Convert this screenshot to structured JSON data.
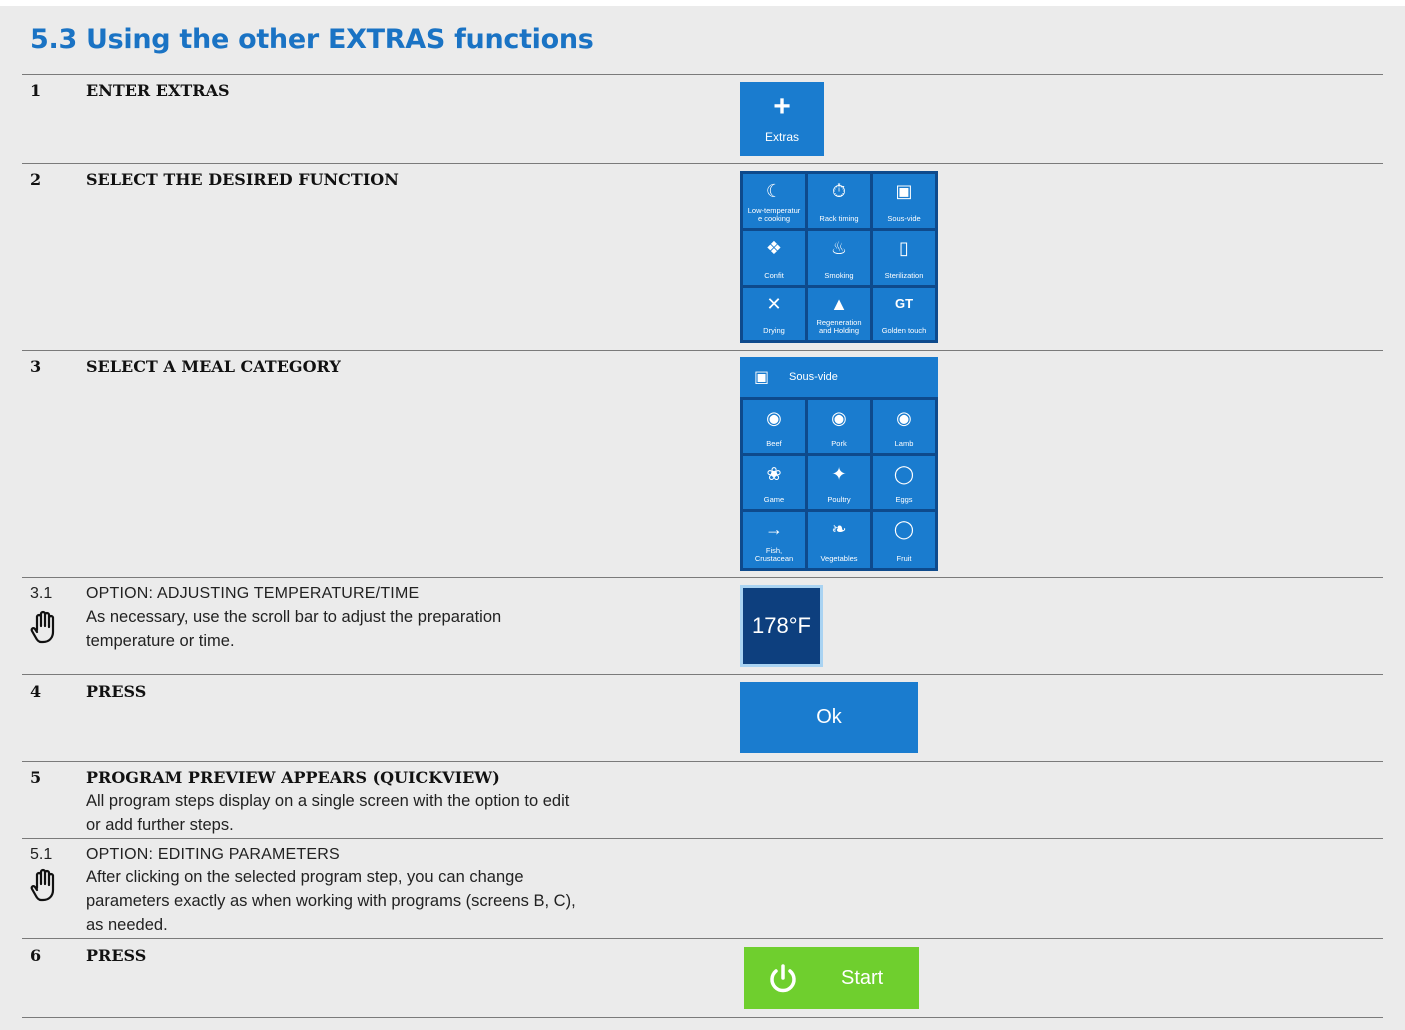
{
  "title": "5.3 Using the other EXTRAS functions",
  "steps": {
    "s1": {
      "num": "1",
      "head": "ENTER EXTRAS"
    },
    "s2": {
      "num": "2",
      "head": "SELECT THE DESIRED FUNCTION"
    },
    "s3": {
      "num": "3",
      "head": "SELECT A MEAL CATEGORY"
    },
    "s31": {
      "num": "3.1",
      "head": "OPTION: ADJUSTING TEMPERATURE/TIME",
      "line1": "As necessary, use the scroll bar to adjust the preparation",
      "line2": "temperature or time."
    },
    "s4": {
      "num": "4",
      "head": "PRESS"
    },
    "s5": {
      "num": "5",
      "head": "PROGRAM PREVIEW APPEARS (QUICKVIEW)",
      "line1": "All program steps display on a single screen with the option to edit",
      "line2": "or add further steps."
    },
    "s51": {
      "num": "5.1",
      "head": "OPTION: EDITING PARAMETERS",
      "line1": "After clicking on the selected program step, you can change",
      "line2": "parameters exactly as when working with programs (screens B, C),",
      "line3": "as needed."
    },
    "s6": {
      "num": "6",
      "head": "PRESS"
    }
  },
  "extras_button": {
    "label": "Extras",
    "icon": "plus-icon"
  },
  "functions": [
    {
      "label": "Low-temperatur e cooking",
      "l1": "Low-temperatur",
      "l2": "e cooking",
      "icon": "moon-chicken-icon"
    },
    {
      "label": "Rack timing",
      "icon": "stopwatch-icon"
    },
    {
      "label": "Sous-vide",
      "icon": "vacuum-bag-icon"
    },
    {
      "label": "Confit",
      "icon": "duck-icon"
    },
    {
      "label": "Smoking",
      "icon": "smoke-bowl-icon"
    },
    {
      "label": "Sterilization",
      "icon": "jar-icon"
    },
    {
      "label": "Drying",
      "icon": "dry-pear-icon"
    },
    {
      "label": "Regeneration and Holding",
      "l1": "Regeneration",
      "l2": "and Holding",
      "icon": "cloche-icon"
    },
    {
      "label": "Golden touch",
      "icon": "gt-icon"
    }
  ],
  "category_panel": {
    "header": "Sous-vide",
    "header_icon": "vacuum-bag-icon"
  },
  "categories": [
    {
      "label": "Beef",
      "icon": "cow-icon"
    },
    {
      "label": "Pork",
      "icon": "pig-icon"
    },
    {
      "label": "Lamb",
      "icon": "sheep-icon"
    },
    {
      "label": "Game",
      "icon": "deer-icon"
    },
    {
      "label": "Poultry",
      "icon": "chicken-icon"
    },
    {
      "label": "Eggs",
      "icon": "egg-icon"
    },
    {
      "label": "Fish, Crustacean",
      "l1": "Fish,",
      "l2": "Crustacean",
      "icon": "fish-icon"
    },
    {
      "label": "Vegetables",
      "icon": "carrot-icon"
    },
    {
      "label": "Fruit",
      "icon": "pear-icon"
    }
  ],
  "temperature": {
    "value": "178°F"
  },
  "ok_button": {
    "label": "Ok"
  },
  "start_button": {
    "label": "Start",
    "icon": "power-icon"
  },
  "colors": {
    "title": "#1a73c4",
    "button_blue": "#1a7ccf",
    "panel_dark": "#0e4a8c",
    "start_green": "#6fcf2e",
    "background": "#ebebeb"
  }
}
